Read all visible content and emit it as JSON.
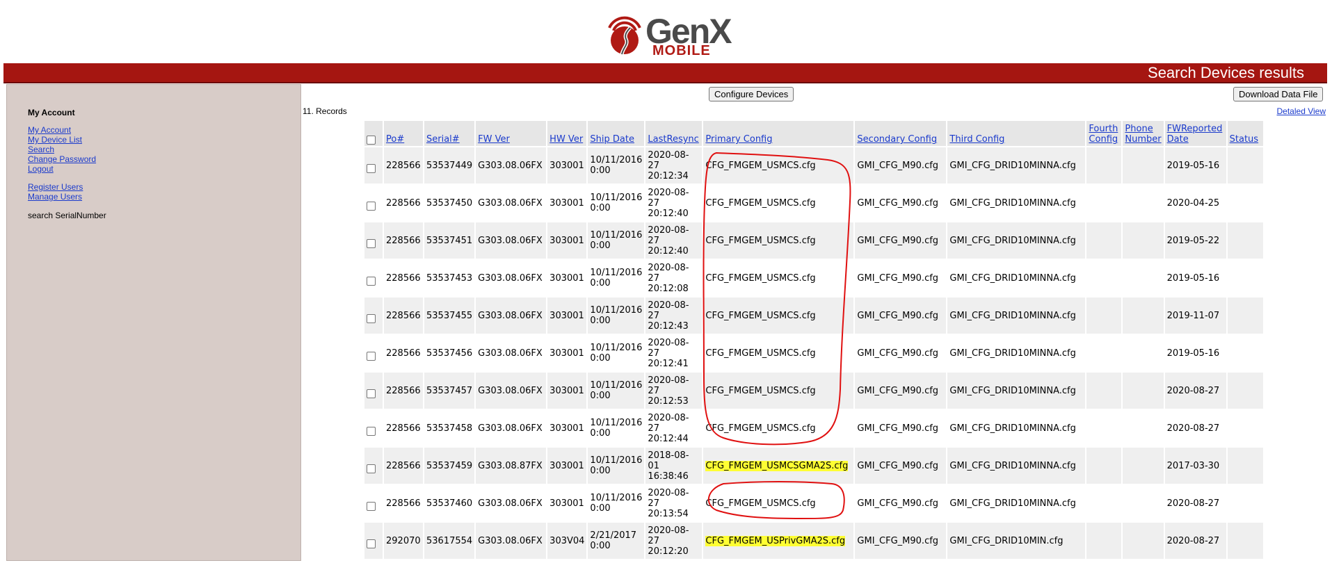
{
  "header": {
    "logo_word": "GenX",
    "logo_sub": "MOBILE",
    "logo_icon": "genx-road-signal-icon",
    "page_title": "Search Devices results"
  },
  "sidebar": {
    "heading": "My Account",
    "links_group1": [
      "My Account",
      "My Device List",
      "Search",
      "Change Password",
      "Logout"
    ],
    "links_group2": [
      "Register Users",
      "Manage Users"
    ],
    "search_label": "search SerialNumber"
  },
  "toolbar": {
    "configure_label": "Configure Devices",
    "download_label": "Download Data File",
    "records_text": "11. Records",
    "detailed_view": "Detaled View"
  },
  "table": {
    "headers": [
      "Po#",
      "Serial#",
      "FW Ver",
      "HW Ver",
      "Ship Date",
      "LastResync",
      "Primary Config",
      "Secondary Config",
      "Third Config",
      "Fourth Config",
      "Phone Number",
      "FWReported Date",
      "Status"
    ],
    "rows": [
      {
        "po": "228566",
        "serial": "53537449",
        "fw": "G303.08.06FX",
        "hw": "303001",
        "ship": "10/11/2016 0:00",
        "resync": "2020-08-27 20:12:34",
        "primary": "CFG_FMGEM_USMCS.cfg",
        "secondary": "GMI_CFG_M90.cfg",
        "third": "GMI_CFG_DRID10MINNA.cfg",
        "fourth": "",
        "phone": "",
        "fwdate": "2019-05-16",
        "status": "",
        "highlight": false
      },
      {
        "po": "228566",
        "serial": "53537450",
        "fw": "G303.08.06FX",
        "hw": "303001",
        "ship": "10/11/2016 0:00",
        "resync": "2020-08-27 20:12:40",
        "primary": "CFG_FMGEM_USMCS.cfg",
        "secondary": "GMI_CFG_M90.cfg",
        "third": "GMI_CFG_DRID10MINNA.cfg",
        "fourth": "",
        "phone": "",
        "fwdate": "2020-04-25",
        "status": "",
        "highlight": false
      },
      {
        "po": "228566",
        "serial": "53537451",
        "fw": "G303.08.06FX",
        "hw": "303001",
        "ship": "10/11/2016 0:00",
        "resync": "2020-08-27 20:12:40",
        "primary": "CFG_FMGEM_USMCS.cfg",
        "secondary": "GMI_CFG_M90.cfg",
        "third": "GMI_CFG_DRID10MINNA.cfg",
        "fourth": "",
        "phone": "",
        "fwdate": "2019-05-22",
        "status": "",
        "highlight": false
      },
      {
        "po": "228566",
        "serial": "53537453",
        "fw": "G303.08.06FX",
        "hw": "303001",
        "ship": "10/11/2016 0:00",
        "resync": "2020-08-27 20:12:08",
        "primary": "CFG_FMGEM_USMCS.cfg",
        "secondary": "GMI_CFG_M90.cfg",
        "third": "GMI_CFG_DRID10MINNA.cfg",
        "fourth": "",
        "phone": "",
        "fwdate": "2019-05-16",
        "status": "",
        "highlight": false
      },
      {
        "po": "228566",
        "serial": "53537455",
        "fw": "G303.08.06FX",
        "hw": "303001",
        "ship": "10/11/2016 0:00",
        "resync": "2020-08-27 20:12:43",
        "primary": "CFG_FMGEM_USMCS.cfg",
        "secondary": "GMI_CFG_M90.cfg",
        "third": "GMI_CFG_DRID10MINNA.cfg",
        "fourth": "",
        "phone": "",
        "fwdate": "2019-11-07",
        "status": "",
        "highlight": false
      },
      {
        "po": "228566",
        "serial": "53537456",
        "fw": "G303.08.06FX",
        "hw": "303001",
        "ship": "10/11/2016 0:00",
        "resync": "2020-08-27 20:12:41",
        "primary": "CFG_FMGEM_USMCS.cfg",
        "secondary": "GMI_CFG_M90.cfg",
        "third": "GMI_CFG_DRID10MINNA.cfg",
        "fourth": "",
        "phone": "",
        "fwdate": "2019-05-16",
        "status": "",
        "highlight": false
      },
      {
        "po": "228566",
        "serial": "53537457",
        "fw": "G303.08.06FX",
        "hw": "303001",
        "ship": "10/11/2016 0:00",
        "resync": "2020-08-27 20:12:53",
        "primary": "CFG_FMGEM_USMCS.cfg",
        "secondary": "GMI_CFG_M90.cfg",
        "third": "GMI_CFG_DRID10MINNA.cfg",
        "fourth": "",
        "phone": "",
        "fwdate": "2020-08-27",
        "status": "",
        "highlight": false
      },
      {
        "po": "228566",
        "serial": "53537458",
        "fw": "G303.08.06FX",
        "hw": "303001",
        "ship": "10/11/2016 0:00",
        "resync": "2020-08-27 20:12:44",
        "primary": "CFG_FMGEM_USMCS.cfg",
        "secondary": "GMI_CFG_M90.cfg",
        "third": "GMI_CFG_DRID10MINNA.cfg",
        "fourth": "",
        "phone": "",
        "fwdate": "2020-08-27",
        "status": "",
        "highlight": false
      },
      {
        "po": "228566",
        "serial": "53537459",
        "fw": "G303.08.87FX",
        "hw": "303001",
        "ship": "10/11/2016 0:00",
        "resync": "2018-08-01 16:38:46",
        "primary": "CFG_FMGEM_USMCSGMA2S.cfg",
        "secondary": "GMI_CFG_M90.cfg",
        "third": "GMI_CFG_DRID10MINNA.cfg",
        "fourth": "",
        "phone": "",
        "fwdate": "2017-03-30",
        "status": "",
        "highlight": true
      },
      {
        "po": "228566",
        "serial": "53537460",
        "fw": "G303.08.06FX",
        "hw": "303001",
        "ship": "10/11/2016 0:00",
        "resync": "2020-08-27 20:13:54",
        "primary": "CFG_FMGEM_USMCS.cfg",
        "secondary": "GMI_CFG_M90.cfg",
        "third": "GMI_CFG_DRID10MINNA.cfg",
        "fourth": "",
        "phone": "",
        "fwdate": "2020-08-27",
        "status": "",
        "highlight": false
      },
      {
        "po": "292070",
        "serial": "53617554",
        "fw": "G303.08.06FX",
        "hw": "303V04",
        "ship": "2/21/2017 0:00",
        "resync": "2020-08-27 20:12:20",
        "primary": "CFG_FMGEM_USPrivGMA2S.cfg",
        "secondary": "GMI_CFG_M90.cfg",
        "third": "GMI_CFG_DRID10MIN.cfg",
        "fourth": "",
        "phone": "",
        "fwdate": "2020-08-27",
        "status": "",
        "highlight": true
      }
    ]
  },
  "colors": {
    "title_bar": "#a51611",
    "sidebar_bg": "#d8ccc8",
    "link": "#1a3acc",
    "highlight": "#ffff33",
    "annotation": "#e01010"
  }
}
